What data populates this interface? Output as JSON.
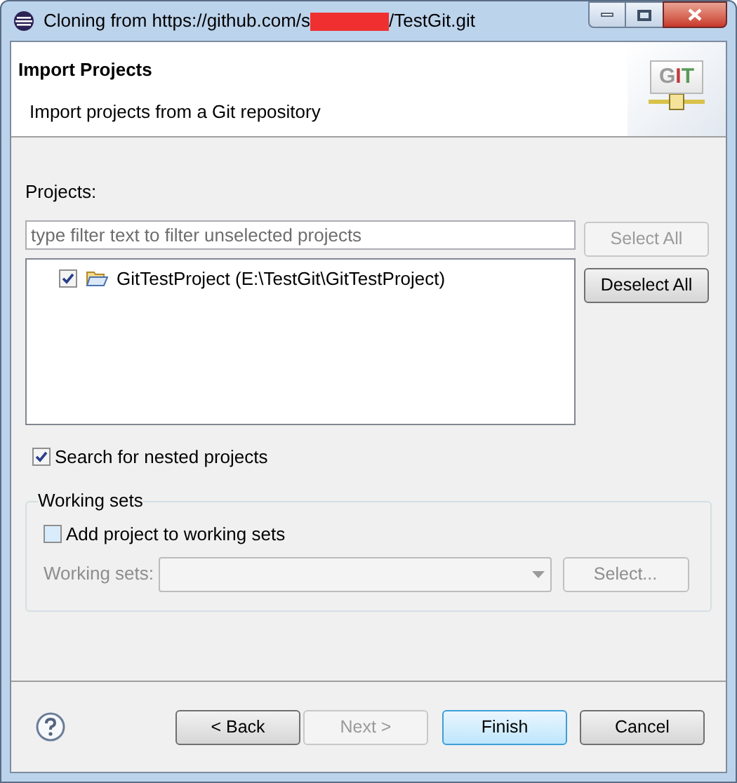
{
  "window": {
    "title_start": "Cloning from https://github.com/s",
    "title_end": "/TestGit.git",
    "redacted": true
  },
  "header": {
    "title": "Import Projects",
    "description": "Import projects from a Git repository",
    "logo": [
      {
        "char": "G",
        "color": "#9a9a9a"
      },
      {
        "char": "I",
        "color": "#c0393b"
      },
      {
        "char": "T",
        "color": "#5a9a5a"
      }
    ]
  },
  "projects": {
    "label": "Projects:",
    "filter": {
      "placeholder": "type filter text to filter unselected projects"
    },
    "items": [
      {
        "label": "GitTestProject (E:\\TestGit\\GitTestProject)",
        "checked": true
      }
    ],
    "buttons": [
      {
        "label": "Select All",
        "disabled": true
      },
      {
        "label": "Deselect All",
        "disabled": false
      }
    ]
  },
  "search_nested": {
    "label": "Search for nested projects",
    "checked": true
  },
  "working_sets": {
    "title": "Working sets",
    "add": {
      "label": "Add project to working sets",
      "checked": false
    },
    "field_label": "Working sets:",
    "disabled": true,
    "select_button": "Select..."
  },
  "footer": {
    "buttons": [
      {
        "label": "< Back",
        "disabled": false,
        "default": false
      },
      {
        "label": "Next >",
        "disabled": true,
        "default": false
      },
      {
        "label": "Finish",
        "disabled": false,
        "default": true
      },
      {
        "label": "Cancel",
        "disabled": false,
        "default": false
      }
    ]
  }
}
